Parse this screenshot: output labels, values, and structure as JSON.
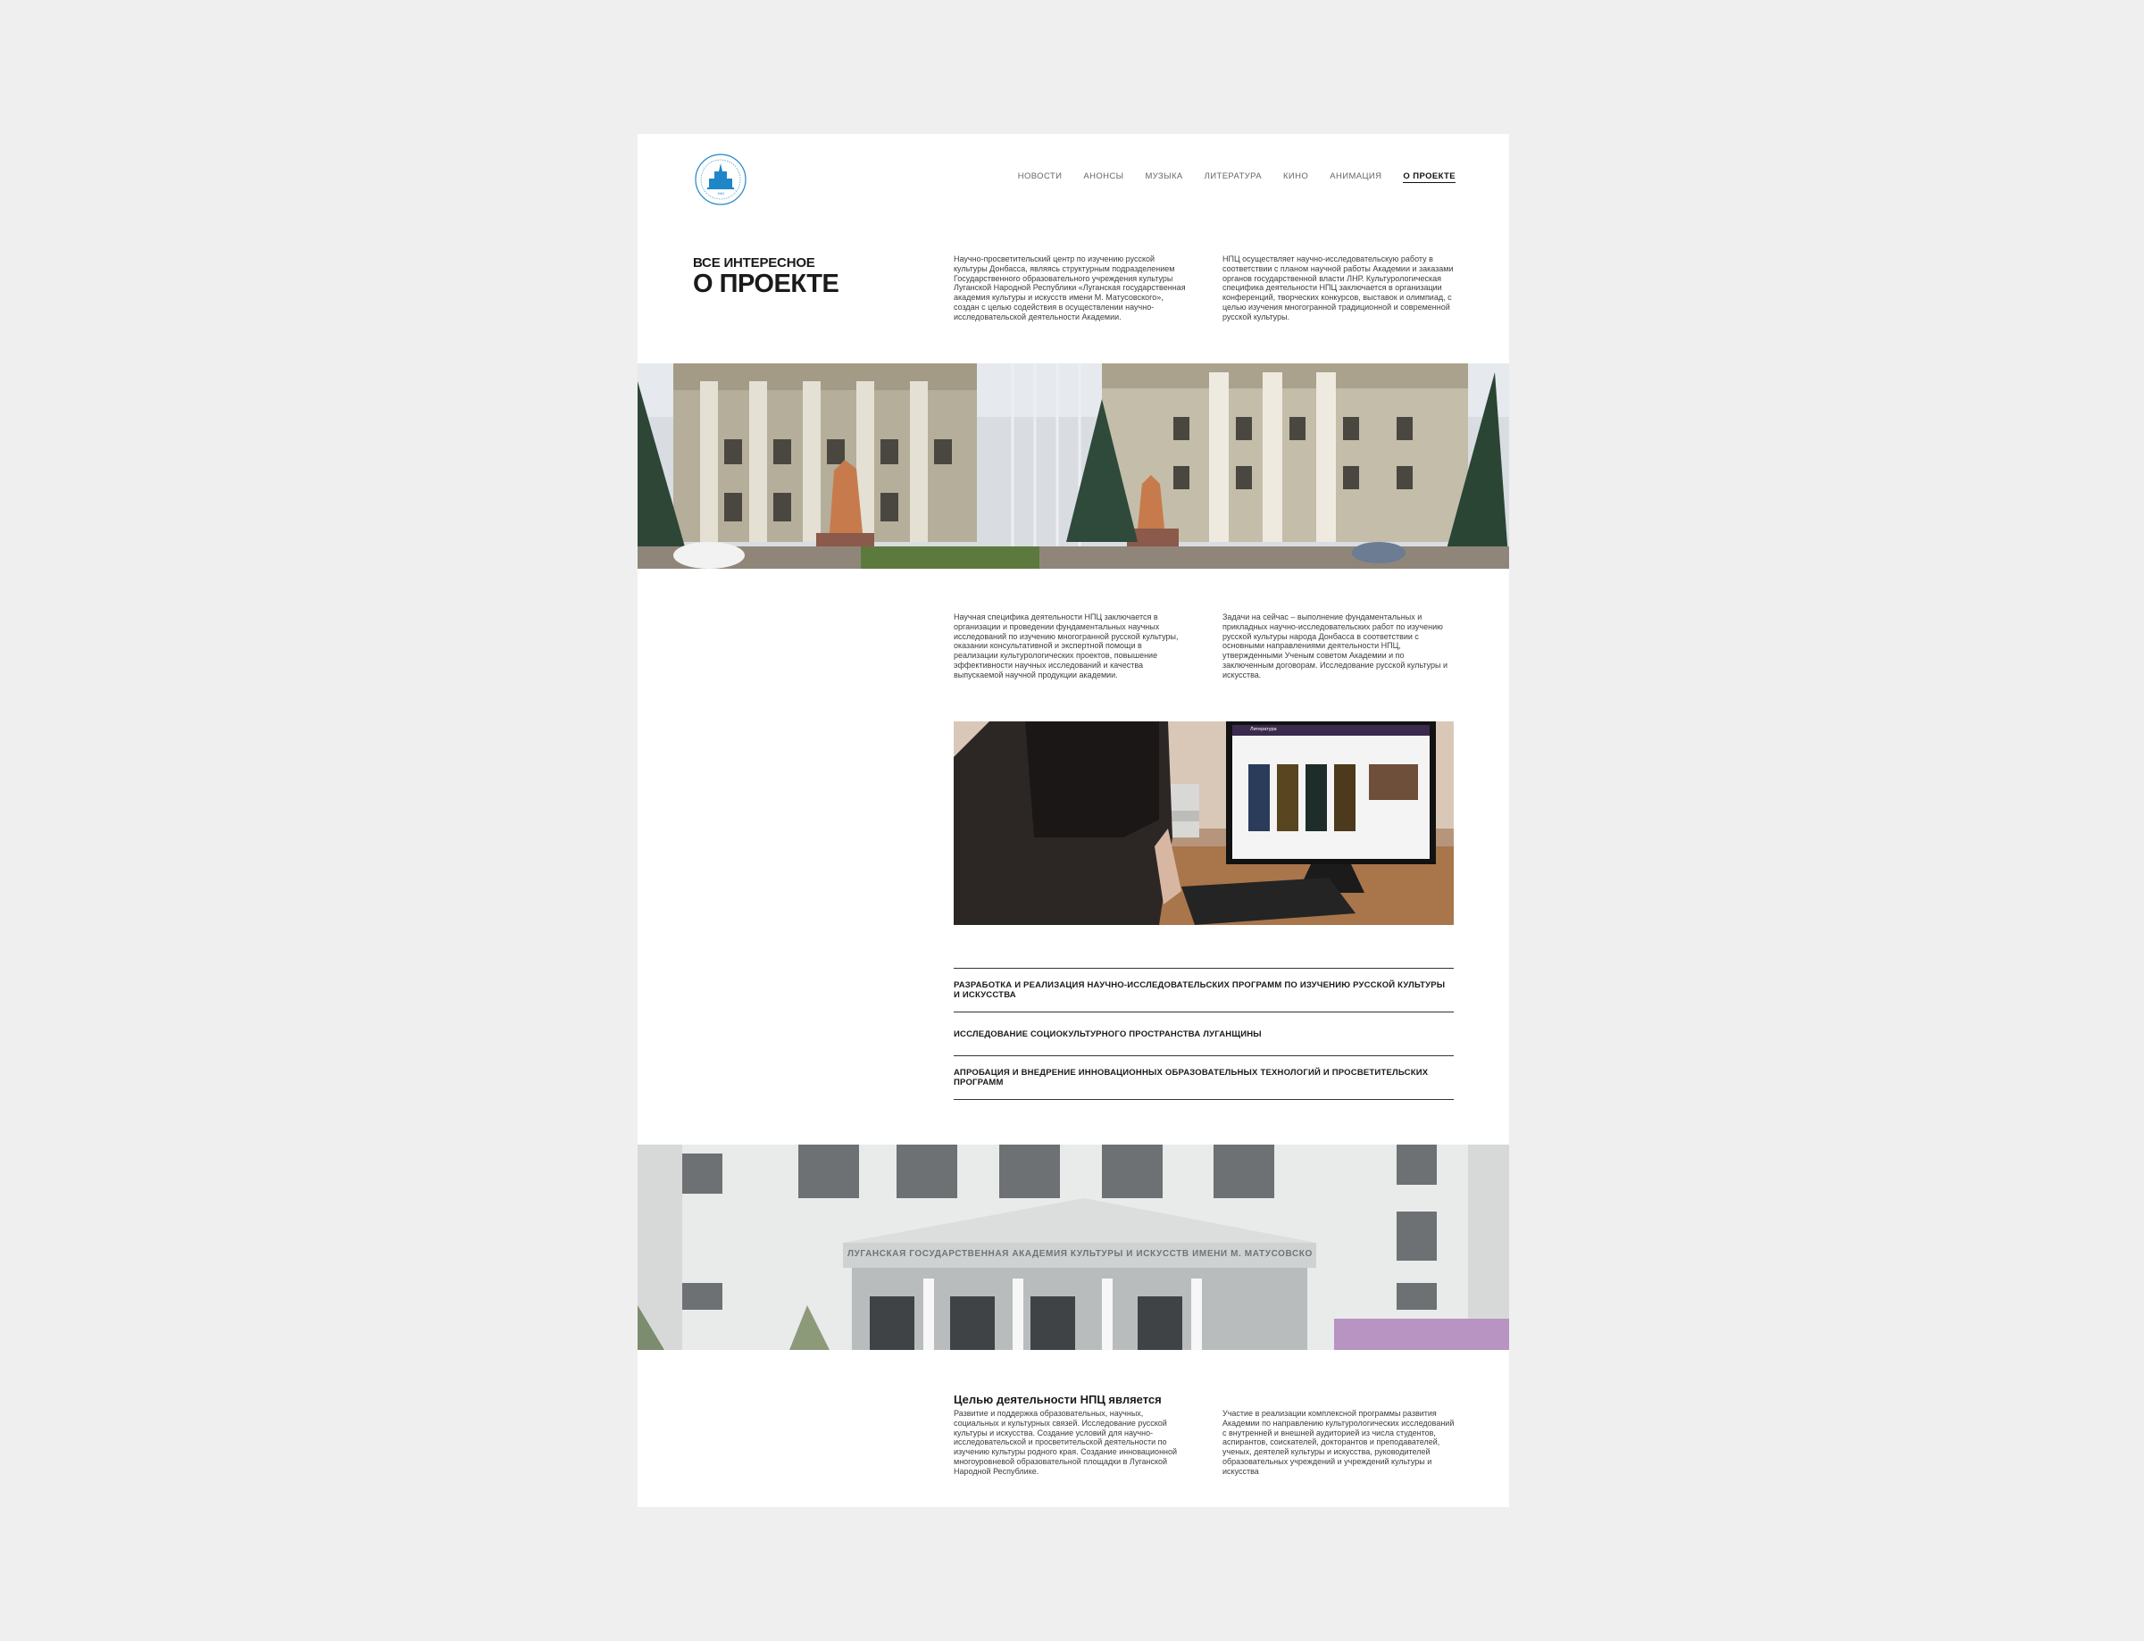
{
  "header": {
    "logo": {
      "icon": "academy-emblem-icon",
      "color": "#1f86c8"
    },
    "nav": [
      {
        "label": "НОВОСТИ",
        "active": false
      },
      {
        "label": "АНОНСЫ",
        "active": false
      },
      {
        "label": "МУЗЫКА",
        "active": false
      },
      {
        "label": "ЛИТЕРАТУРА",
        "active": false
      },
      {
        "label": "КИНО",
        "active": false
      },
      {
        "label": "АНИМАЦИЯ",
        "active": false
      },
      {
        "label": "О ПРОЕКТЕ",
        "active": true
      }
    ]
  },
  "intro": {
    "eyebrow": "ВСЕ ИНТЕРЕСНОЕ",
    "title": "О ПРОЕКТЕ",
    "col1": "Научно-просветительский центр по изучению русской культуры Донбасса, являясь структурным подразделением Государственного образовательного учреждения культуры Луганской Народной Республики «Луганская государственная академия культуры и искусств имени М. Матусовского», создан с целью содействия в осуществлении научно-исследовательской деятельности Академии.",
    "col2": "НПЦ осуществляет научно-исследовательскую работу в соответствии с планом научной работы Академии и заказами органов государственной власти ЛНР. Культурологическая специфика деятельности НПЦ заключается в организации конференций, творческих конкурсов, выставок и олимпиад, с целью изучения многогранной традиционной и современной русской культуры."
  },
  "section2": {
    "col1": "Научная специфика деятельности НПЦ заключается в организации и проведении фундаментальных научных исследований по изучению многогранной русской культуры, оказании консультативной и экспертной помощи в реализации культурологических проектов, повышение эффективности научных исследований и качества выпускаемой научной продукции академии.",
    "col2": "Задачи на сейчас – выполнение фундаментальных и прикладных научно-исследовательских работ по изучению русской культуры народа Донбасса в соответствии с основными направлениями деятельности НПЦ, утвержденными Ученым советом Академии и по заключенным договорам. Исследование русской культуры и искусства."
  },
  "screen_header": "Литература",
  "directions": [
    "РАЗРАБОТКА И РЕАЛИЗАЦИЯ НАУЧНО-ИССЛЕДОВАТЕЛЬСКИХ ПРОГРАММ ПО ИЗУЧЕНИЮ РУССКОЙ КУЛЬТУРЫ И ИСКУССТВА",
    "ИССЛЕДОВАНИЕ СОЦИОКУЛЬТУРНОГО ПРОСТРАНСТВА ЛУГАНЩИНЫ",
    "АПРОБАЦИЯ И ВНЕДРЕНИЕ ИННОВАЦИОННЫХ ОБРАЗОВАТЕЛЬНЫХ ТЕХНОЛОГИЙ И ПРОСВЕТИТЕЛЬСКИХ ПРОГРАММ"
  ],
  "facade_sign": "ЛУГАНСКАЯ ГОСУДАРСТВЕННАЯ АКАДЕМИЯ КУЛЬТУРЫ И ИСКУССТВ ИМЕНИ М. МАТУСОВСКОГО",
  "goal": {
    "title": "Целью деятельности НПЦ является",
    "col1": "Развитие и поддержка образовательных, научных, социальных и культурных связей. Исследование русской культуры и искусства. Создание условий для научно-исследовательской и просветительской деятельности по изучению культуры родного края. Создание инновационной многоуровневой образовательной площадки в Луганской Народной Республике.",
    "col2": "Участие в реализации комплексной программы развития Академии по направлению культурологических исследований с внутренней и внешней аудиторией из числа студентов, аспирантов, соискателей, докторантов и преподавателей, ученых, деятелей культуры и искусства, руководителей образовательных учреждений и учреждений культуры и искусства"
  }
}
